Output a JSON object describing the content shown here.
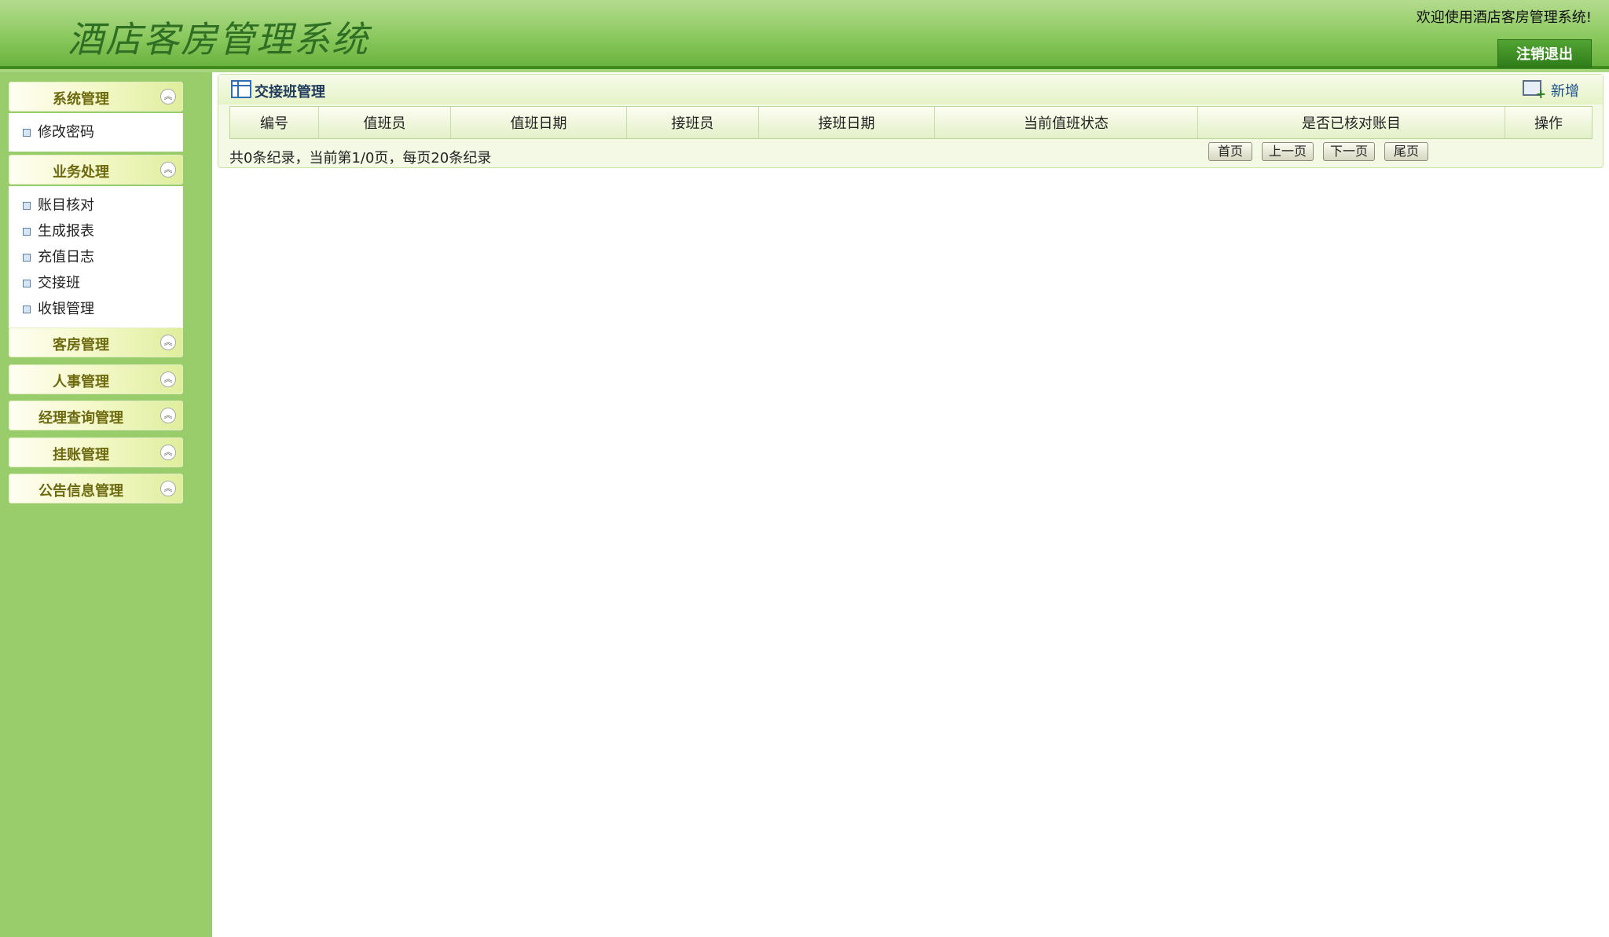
{
  "header": {
    "title": "酒店客房管理系统",
    "welcome": "欢迎使用酒店客房管理系统!",
    "logout_label": "注销退出"
  },
  "sidebar": {
    "groups": [
      {
        "label": "系统管理",
        "items": [
          "修改密码"
        ]
      },
      {
        "label": "业务处理",
        "items": [
          "账目核对",
          "生成报表",
          "充值日志",
          "交接班",
          "收银管理"
        ]
      },
      {
        "label": "客房管理"
      },
      {
        "label": "人事管理"
      },
      {
        "label": "经理查询管理"
      },
      {
        "label": "挂账管理"
      },
      {
        "label": "公告信息管理"
      }
    ]
  },
  "panel": {
    "title": "交接班管理",
    "add_label": "新增",
    "columns": [
      "编号",
      "值班员",
      "值班日期",
      "接班员",
      "接班日期",
      "当前值班状态",
      "是否已核对账目",
      "操作"
    ],
    "rows": [],
    "pager_info": "共0条纪录，当前第1/0页，每页20条纪录",
    "pager": {
      "first": "首页",
      "prev": "上一页",
      "next": "下一页",
      "last": "尾页"
    }
  }
}
